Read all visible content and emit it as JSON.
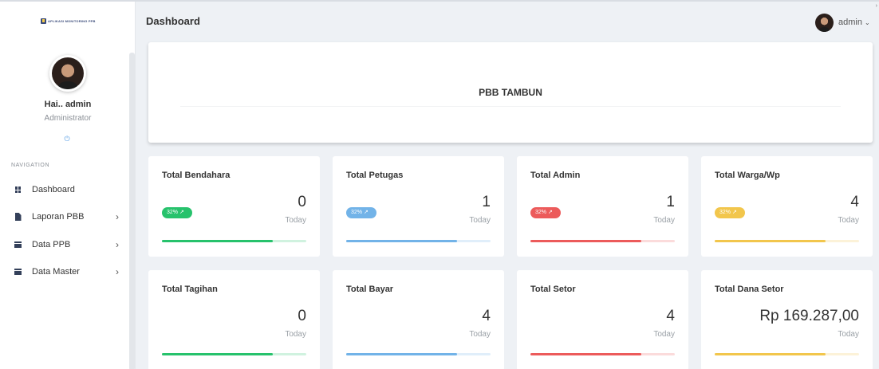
{
  "app": {
    "logo_text": "APLIKASI MONITORING PPB"
  },
  "sidebar": {
    "greeting": "Hai.. admin",
    "role": "Administrator",
    "nav_heading": "NAVIGATION",
    "items": [
      {
        "label": "Dashboard",
        "icon": "dashboard-icon",
        "has_submenu": false
      },
      {
        "label": "Laporan PBB",
        "icon": "file-icon",
        "has_submenu": true
      },
      {
        "label": "Data PPB",
        "icon": "archive-icon",
        "has_submenu": true
      },
      {
        "label": "Data Master",
        "icon": "archive-icon",
        "has_submenu": true
      }
    ],
    "chevron": "›"
  },
  "header": {
    "title": "Dashboard",
    "user": "admin",
    "user_chevron": "⌄"
  },
  "hero": {
    "title": "PBB TAMBUN"
  },
  "cards": [
    {
      "title": "Total Bendahara",
      "value": "0",
      "period": "Today",
      "badge": "32%",
      "color": "#27c26c",
      "progress": 0.77
    },
    {
      "title": "Total Petugas",
      "value": "1",
      "period": "Today",
      "badge": "32%",
      "color": "#72b3e8",
      "progress": 0.77
    },
    {
      "title": "Total Admin",
      "value": "1",
      "period": "Today",
      "badge": "32%",
      "color": "#ec5b5b",
      "progress": 0.77
    },
    {
      "title": "Total Warga/Wp",
      "value": "4",
      "period": "Today",
      "badge": "32%",
      "color": "#f2c64c",
      "progress": 0.77
    },
    {
      "title": "Total Tagihan",
      "value": "0",
      "period": "Today",
      "color": "#27c26c",
      "progress": 0.77
    },
    {
      "title": "Total Bayar",
      "value": "4",
      "period": "Today",
      "color": "#72b3e8",
      "progress": 0.77
    },
    {
      "title": "Total Setor",
      "value": "4",
      "period": "Today",
      "color": "#ec5b5b",
      "progress": 0.77
    },
    {
      "title": "Total Dana Setor",
      "value": "Rp 169.287,00",
      "period": "Today",
      "color": "#f2c64c",
      "progress": 0.77
    }
  ]
}
